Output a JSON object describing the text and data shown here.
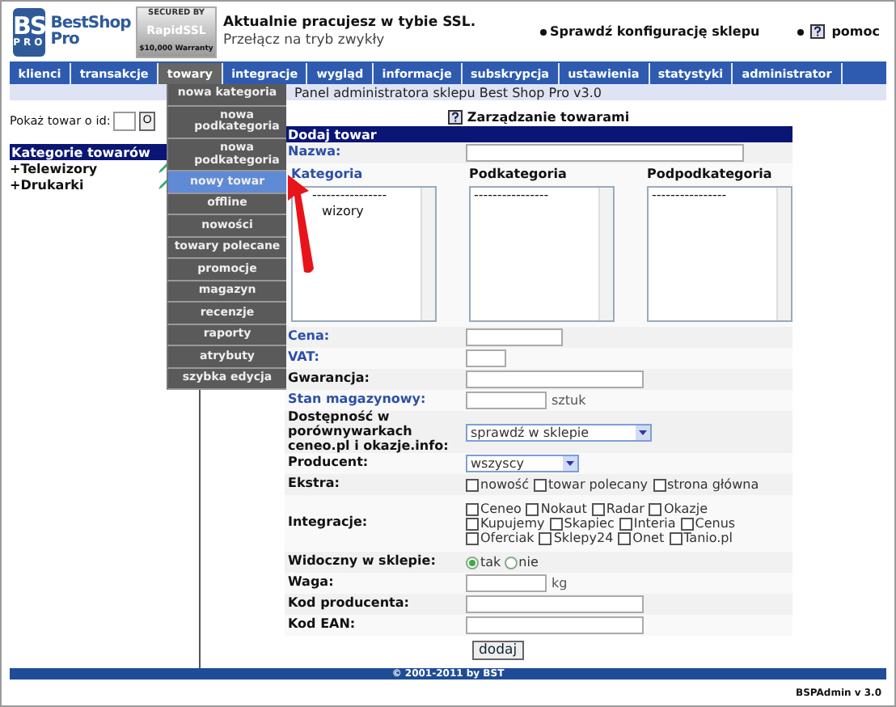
{
  "header": {
    "logo": {
      "top": "BS",
      "bottom": "PRO",
      "name_line1": "BestShop",
      "name_line2": "Pro"
    },
    "ssl_badge": {
      "top": "SECURED BY",
      "brand": "RapidSSL",
      "bottom": "$10,000 Warranty"
    },
    "ssl_title": "Aktualnie pracujesz w tybie SSL.",
    "ssl_link": "Przełącz na tryb zwykły",
    "config_link": "Sprawdź konfigurację sklepu",
    "help_link": "pomoc"
  },
  "nav": [
    {
      "label": "klienci",
      "selected": false
    },
    {
      "label": "transakcje",
      "selected": false
    },
    {
      "label": "towary",
      "selected": true
    },
    {
      "label": "integracje",
      "selected": false
    },
    {
      "label": "wygląd",
      "selected": false
    },
    {
      "label": "informacje",
      "selected": false
    },
    {
      "label": "subskrypcja",
      "selected": false
    },
    {
      "label": "ustawienia",
      "selected": false
    },
    {
      "label": "statystyki",
      "selected": false
    },
    {
      "label": "administrator",
      "selected": false
    }
  ],
  "subtitle": "Panel administratora sklepu Best Shop Pro v3.0",
  "menu": [
    {
      "label": "nowa kategoria",
      "selected": false
    },
    {
      "label": "nowa podkategoria",
      "selected": false
    },
    {
      "label": "nowa podkategoria",
      "selected": false
    },
    {
      "label": "nowy towar",
      "selected": true
    },
    {
      "label": "offline",
      "selected": false
    },
    {
      "label": "nowości",
      "selected": false
    },
    {
      "label": "towary polecane",
      "selected": false
    },
    {
      "label": "promocje",
      "selected": false
    },
    {
      "label": "magazyn",
      "selected": false
    },
    {
      "label": "recenzje",
      "selected": false
    },
    {
      "label": "raporty",
      "selected": false
    },
    {
      "label": "atrybuty",
      "selected": false
    },
    {
      "label": "szybka edycja",
      "selected": false
    }
  ],
  "sidebar": {
    "id_label": "Pokaż towar o id:",
    "id_button": "O",
    "categories_title": "Kategorie towarów",
    "categories": [
      "+Telewizory",
      "+Drukarki"
    ]
  },
  "section_title": "Zarządzanie towarami",
  "form": {
    "title": "Dodaj towar",
    "name": {
      "label": "Nazwa:",
      "required": true
    },
    "lists": [
      {
        "label": "Kategoria",
        "required": true,
        "options": [
          "----------------",
          "wizory"
        ]
      },
      {
        "label": "Podkategoria",
        "required": false,
        "options": [
          "----------------"
        ]
      },
      {
        "label": "Podpodkategoria",
        "required": false,
        "options": [
          "----------------"
        ]
      }
    ],
    "rows": [
      {
        "kind": "text",
        "label": "Cena:",
        "required": true
      },
      {
        "kind": "text",
        "label": "VAT:",
        "required": true
      },
      {
        "kind": "text",
        "label": "Gwarancja:",
        "required": false
      },
      {
        "kind": "text",
        "label": "Stan magazynowy:",
        "required": true,
        "suffix": "sztuk"
      },
      {
        "kind": "select",
        "label": "Dostępność w porównywarkach ceneo.pl i okazje.info:",
        "required": false,
        "value": "sprawdź w sklepie"
      },
      {
        "kind": "select",
        "label": "Producent:",
        "required": false,
        "value": "wszyscy"
      },
      {
        "kind": "checks",
        "label": "Ekstra:",
        "required": false,
        "options": [
          {
            "label": "nowość",
            "checked": false
          },
          {
            "label": "towar polecany",
            "checked": false
          },
          {
            "label": "strona główna",
            "checked": false
          }
        ]
      },
      {
        "kind": "checks",
        "label": "Integracje:",
        "required": false,
        "options": [
          {
            "label": "Ceneo",
            "checked": false
          },
          {
            "label": "Nokaut",
            "checked": false
          },
          {
            "label": "Radar",
            "checked": false
          },
          {
            "label": "Okazje",
            "checked": false
          },
          {
            "label": "Kupujemy",
            "checked": false
          },
          {
            "label": "Skapiec",
            "checked": false
          },
          {
            "label": "Interia",
            "checked": false
          },
          {
            "label": "Cenus",
            "checked": false
          },
          {
            "label": "Oferciak",
            "checked": false
          },
          {
            "label": "Sklepy24",
            "checked": false
          },
          {
            "label": "Onet",
            "checked": false
          },
          {
            "label": "Tanio.pl",
            "checked": false
          }
        ]
      },
      {
        "kind": "radios",
        "label": "Widoczny w sklepie:",
        "required": false,
        "options": [
          {
            "label": "tak",
            "selected": true
          },
          {
            "label": "nie",
            "selected": false
          }
        ]
      },
      {
        "kind": "text",
        "label": "Waga:",
        "required": false,
        "suffix": "kg"
      },
      {
        "kind": "text",
        "label": "Kod producenta:",
        "required": false
      },
      {
        "kind": "text",
        "label": "Kod EAN:",
        "required": false
      }
    ],
    "submit": "dodaj"
  },
  "footer": {
    "copyright": "© 2001-2011 by BST",
    "version": "BSPAdmin v 3.0"
  }
}
